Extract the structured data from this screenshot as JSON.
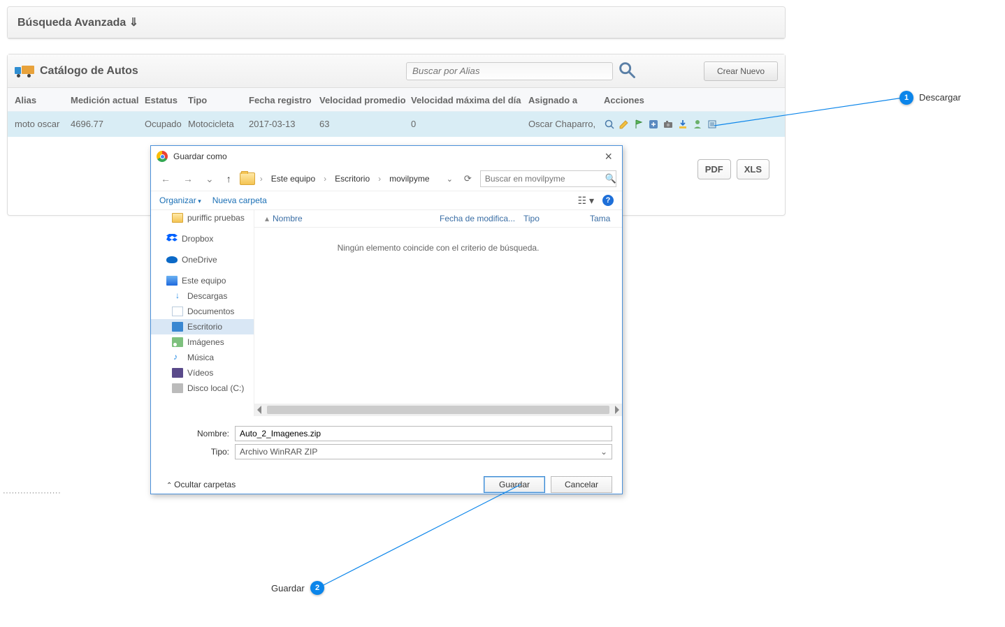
{
  "advanced_search": {
    "title": "Búsqueda Avanzada ⇓"
  },
  "catalog": {
    "title": "Catálogo de Autos",
    "alias_search_placeholder": "Buscar por Alias",
    "create_button": "Crear Nuevo",
    "columns": {
      "alias": "Alias",
      "medicion": "Medición actual",
      "estatus": "Estatus",
      "tipo": "Tipo",
      "fecha": "Fecha registro",
      "vprom": "Velocidad promedio",
      "vmax": "Velocidad máxima del día",
      "asignado": "Asignado a",
      "acciones": "Acciones"
    },
    "rows": [
      {
        "alias": "moto oscar",
        "medicion": "4696.77",
        "estatus": "Ocupado",
        "tipo": "Motocicleta",
        "fecha": "2017-03-13",
        "vprom": "63",
        "vmax": "0",
        "asignado": "Oscar Chaparro,"
      }
    ]
  },
  "export": {
    "pdf": "PDF",
    "xls": "XLS"
  },
  "dialog": {
    "title": "Guardar como",
    "breadcrumb": [
      "Este equipo",
      "Escritorio",
      "movilpyme"
    ],
    "search_placeholder": "Buscar en movilpyme",
    "toolbar": {
      "organize": "Organizar",
      "new_folder": "Nueva carpeta"
    },
    "tree": [
      {
        "label": "puriffic pruebas",
        "icon": "folder",
        "lvl": 1
      },
      {
        "label": "Dropbox",
        "icon": "dropbox",
        "lvl": 0
      },
      {
        "label": "OneDrive",
        "icon": "onedrive",
        "lvl": 0
      },
      {
        "label": "Este equipo",
        "icon": "pc",
        "lvl": 0
      },
      {
        "label": "Descargas",
        "icon": "dl",
        "lvl": 1
      },
      {
        "label": "Documentos",
        "icon": "doc",
        "lvl": 1
      },
      {
        "label": "Escritorio",
        "icon": "desk",
        "lvl": 1,
        "selected": true
      },
      {
        "label": "Imágenes",
        "icon": "img",
        "lvl": 1
      },
      {
        "label": "Música",
        "icon": "music",
        "lvl": 1
      },
      {
        "label": "Vídeos",
        "icon": "vid",
        "lvl": 1
      },
      {
        "label": "Disco local (C:)",
        "icon": "disk",
        "lvl": 1
      }
    ],
    "filehdr": {
      "name": "Nombre",
      "date": "Fecha de modifica...",
      "type": "Tipo",
      "size": "Tama"
    },
    "empty_msg": "Ningún elemento coincide con el criterio de búsqueda.",
    "name_label": "Nombre:",
    "name_value": "Auto_2_Imagenes.zip",
    "type_label": "Tipo:",
    "type_value": "Archivo WinRAR ZIP",
    "hide_folders": "Ocultar carpetas",
    "save": "Guardar",
    "cancel": "Cancelar"
  },
  "annotations": {
    "pin1": "1",
    "label1": "Descargar",
    "pin2": "2",
    "label2": "Guardar"
  }
}
